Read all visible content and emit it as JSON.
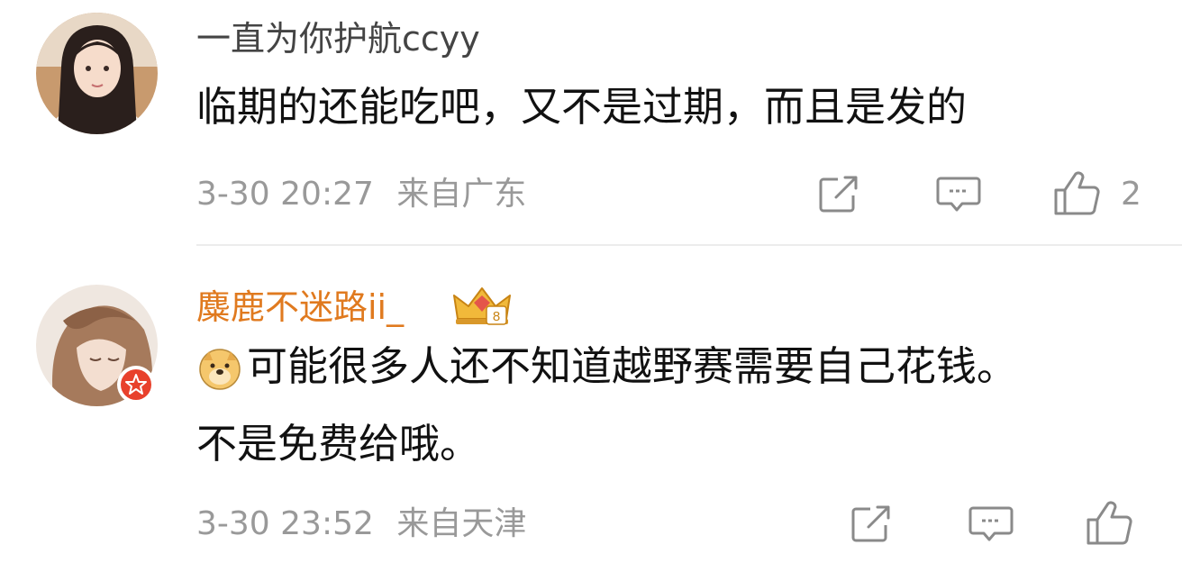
{
  "comments": [
    {
      "username": "一直为你护航ccyy",
      "text_line1": "临期的还能吃吧，又不是过期，而且是发的",
      "time": "3-30 20:27",
      "location": "来自广东",
      "like_count": "2",
      "username_color": "#444444"
    },
    {
      "username": "麋鹿不迷路ii_",
      "text_line1": "可能很多人还不知道越野赛需要自己花钱。",
      "text_line2": "不是免费给哦。",
      "time": "3-30 23:52",
      "location": "来自天津",
      "like_count": "",
      "username_color": "#e07a1f",
      "badge": "crown-badge-icon",
      "verified_badge": "red-star-verified-icon",
      "emoji": "doge-emoji"
    }
  ],
  "icons": {
    "share": "share-icon",
    "reply": "comment-icon",
    "like": "thumbs-up-icon"
  }
}
